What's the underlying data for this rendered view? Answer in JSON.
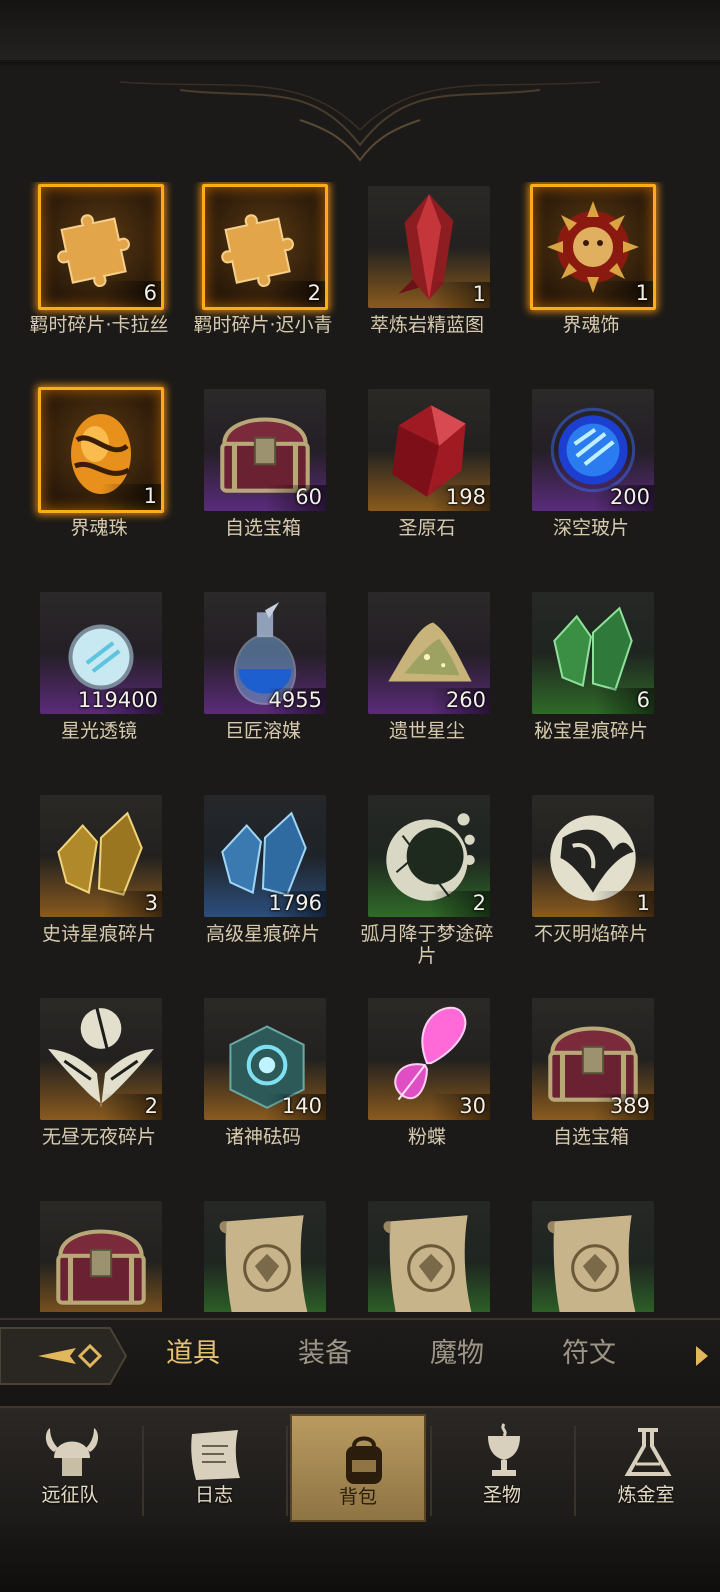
{
  "items": [
    {
      "name": "羁时碎片·卡拉丝",
      "qty": "6",
      "rarity": "gold",
      "icon": "puzzle-piece-icon"
    },
    {
      "name": "羁时碎片·迟小青",
      "qty": "2",
      "rarity": "gold",
      "icon": "puzzle-piece-icon"
    },
    {
      "name": "萃炼岩精蓝图",
      "qty": "1",
      "rarity": "orange",
      "icon": "red-crystal-icon"
    },
    {
      "name": "界魂饰",
      "qty": "1",
      "rarity": "gold",
      "icon": "sun-mask-icon"
    },
    {
      "name": "界魂珠",
      "qty": "1",
      "rarity": "gold",
      "icon": "amber-orb-icon"
    },
    {
      "name": "自选宝箱",
      "qty": "60",
      "rarity": "purple",
      "icon": "treasure-chest-icon"
    },
    {
      "name": "圣原石",
      "qty": "198",
      "rarity": "orange",
      "icon": "ruby-icon"
    },
    {
      "name": "深空玻片",
      "qty": "200",
      "rarity": "purple",
      "icon": "blue-orb-icon"
    },
    {
      "name": "星光透镜",
      "qty": "119400",
      "rarity": "purple",
      "icon": "lens-orb-icon"
    },
    {
      "name": "巨匠溶媒",
      "qty": "4955",
      "rarity": "purple",
      "icon": "potion-flask-icon"
    },
    {
      "name": "遗世星尘",
      "qty": "260",
      "rarity": "purple",
      "icon": "stardust-pile-icon"
    },
    {
      "name": "秘宝星痕碎片",
      "qty": "6",
      "rarity": "green",
      "icon": "green-shard-icon"
    },
    {
      "name": "史诗星痕碎片",
      "qty": "3",
      "rarity": "orange",
      "icon": "gold-shard-icon"
    },
    {
      "name": "高级星痕碎片",
      "qty": "1796",
      "rarity": "blue",
      "icon": "blue-shard-icon"
    },
    {
      "name": "弧月降于梦途碎片",
      "qty": "2",
      "rarity": "green",
      "icon": "crescent-emblem-icon"
    },
    {
      "name": "不灭明焰碎片",
      "qty": "1",
      "rarity": "orange",
      "icon": "phoenix-emblem-icon"
    },
    {
      "name": "无昼无夜碎片",
      "qty": "2",
      "rarity": "orange",
      "icon": "winged-emblem-icon"
    },
    {
      "name": "诸神砝码",
      "qty": "140",
      "rarity": "orange",
      "icon": "rune-cube-icon"
    },
    {
      "name": "粉蝶",
      "qty": "30",
      "rarity": "orange",
      "icon": "pink-butterfly-icon"
    },
    {
      "name": "自选宝箱",
      "qty": "389",
      "rarity": "orange",
      "icon": "treasure-chest-icon"
    },
    {
      "name": "",
      "qty": "",
      "rarity": "orange",
      "icon": "treasure-chest-icon"
    },
    {
      "name": "",
      "qty": "",
      "rarity": "green",
      "icon": "scroll-icon"
    },
    {
      "name": "",
      "qty": "",
      "rarity": "green",
      "icon": "scroll-icon"
    },
    {
      "name": "",
      "qty": "",
      "rarity": "green",
      "icon": "scroll-icon"
    }
  ],
  "tabs": [
    {
      "label": "道具",
      "active": true
    },
    {
      "label": "装备",
      "active": false
    },
    {
      "label": "魔物",
      "active": false
    },
    {
      "label": "符文",
      "active": false
    }
  ],
  "nav": [
    {
      "label": "远征队",
      "icon": "viking-helmet-icon",
      "active": false
    },
    {
      "label": "日志",
      "icon": "journal-scroll-icon",
      "active": false
    },
    {
      "label": "背包",
      "icon": "backpack-icon",
      "active": true
    },
    {
      "label": "圣物",
      "icon": "relic-chalice-icon",
      "active": false
    },
    {
      "label": "炼金室",
      "icon": "alchemy-icon",
      "active": false
    }
  ],
  "colors": {
    "accent": "#e6c173",
    "gold_frame": "#ffab1a",
    "label": "#d6c9ae"
  }
}
